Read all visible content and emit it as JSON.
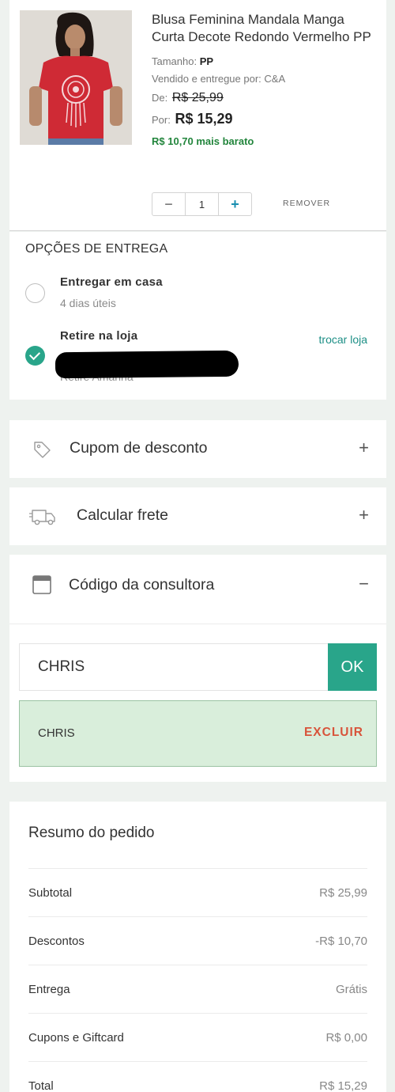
{
  "product": {
    "title": "Blusa Feminina Mandala Manga Curta Decote Redondo Vermelho PP",
    "size_label": "Tamanho:",
    "size_value": "PP",
    "seller": "Vendido e entregue por: C&A",
    "old_price_label": "De:",
    "old_price": "R$ 25,99",
    "price_label": "Por:",
    "price": "R$ 15,29",
    "savings": "R$ 10,70 mais barato",
    "quantity": "1",
    "minus": "−",
    "plus": "+",
    "remove_label": "REMOVER"
  },
  "delivery": {
    "title": "OPÇÕES DE ENTREGA",
    "options": [
      {
        "title": "Entregar em casa",
        "subtitle": "4 dias úteis",
        "selected": false
      },
      {
        "title": "Retire na loja",
        "subtitle": "Retire Amanhã",
        "selected": true
      }
    ],
    "change_store": "trocar loja"
  },
  "accordions": [
    {
      "label": "Cupom de desconto",
      "toggle": "+",
      "icon": "tag-icon"
    },
    {
      "label": "Calcular frete",
      "toggle": "+",
      "icon": "truck-icon"
    },
    {
      "label": "Código da consultora",
      "toggle": "−",
      "icon": "card-icon"
    }
  ],
  "consultant": {
    "input_value": "CHRIS",
    "ok_label": "OK",
    "applied_code": "CHRIS",
    "delete_label": "EXCLUIR"
  },
  "summary": {
    "title": "Resumo do pedido",
    "rows": [
      {
        "label": "Subtotal",
        "value": "R$ 25,99"
      },
      {
        "label": "Descontos",
        "value": "-R$ 10,70"
      },
      {
        "label": "Entrega",
        "value": "Grátis"
      },
      {
        "label": "Cupons e Giftcard",
        "value": "R$ 0,00"
      },
      {
        "label": "Total",
        "value": "R$ 15,29"
      }
    ]
  },
  "colors": {
    "accent": "#29a58a",
    "savings": "#22853c",
    "danger": "#d8543b",
    "applied_bg": "#d9eedb"
  }
}
